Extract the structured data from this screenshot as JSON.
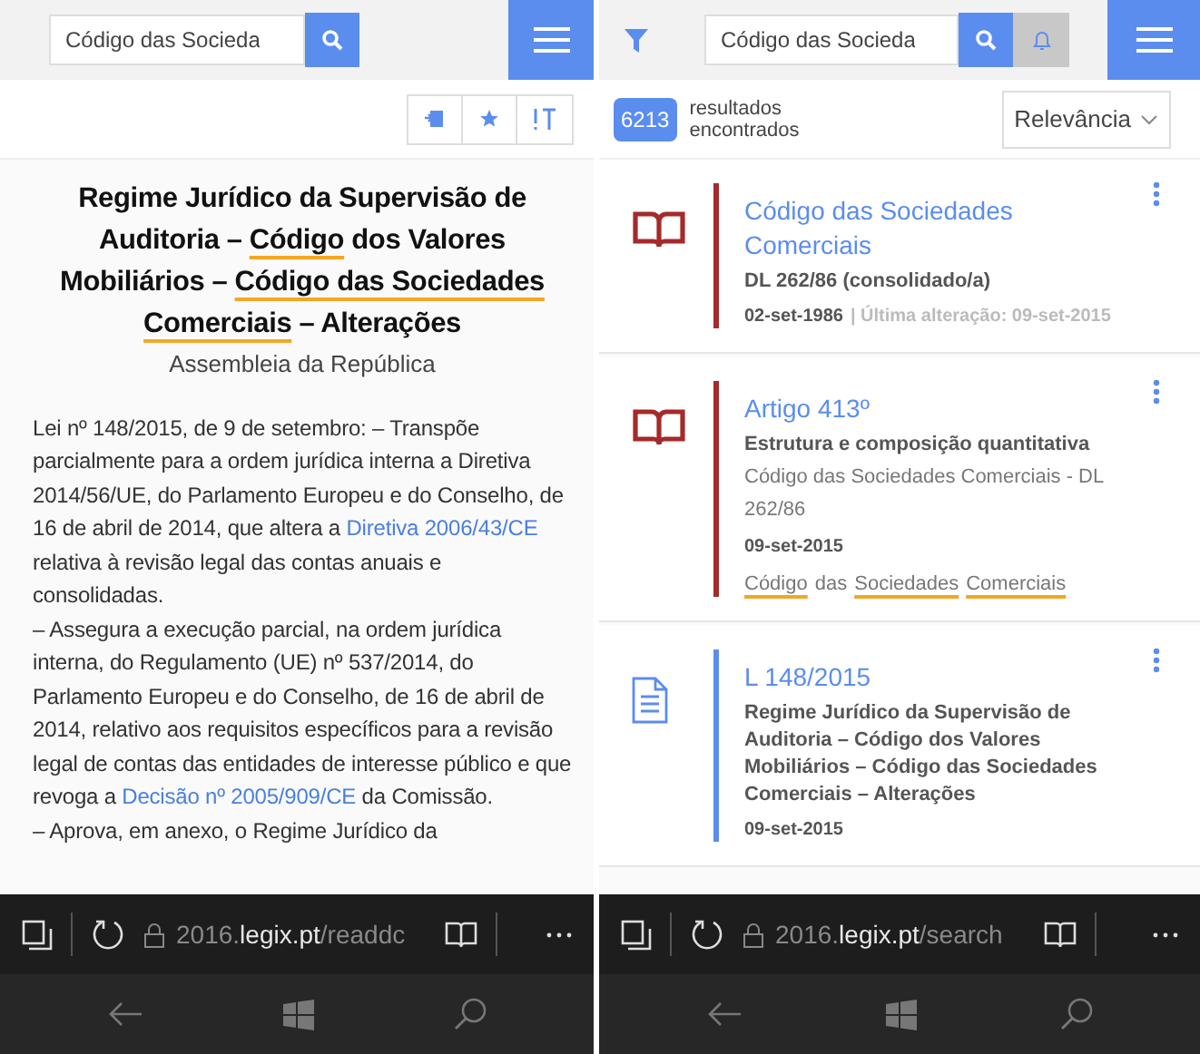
{
  "document_pane": {
    "search": {
      "value": "Código das Socieda"
    },
    "title": [
      {
        "text": "Regime Jurídico da Supervisão de Auditoria – ",
        "highlighted": false
      },
      {
        "text": "Código",
        "highlighted": true
      },
      {
        "text": " dos Valores Mobiliários – ",
        "highlighted": false
      },
      {
        "text": "Código das Sociedades Comerciais",
        "highlighted": true
      },
      {
        "text": " – Alterações",
        "highlighted": false
      }
    ],
    "author": "Assembleia da República",
    "paragraphs": [
      [
        {
          "kind": "text",
          "text": "Lei nº 148/2015, de 9 de setembro: – Transpõe parcialmente para a ordem jurídica interna a Diretiva 2014/56/UE, do Parlamento Europeu e do Conselho, de 16 de abril de 2014, que altera a "
        },
        {
          "kind": "link",
          "text": "Diretiva 2006/43/CE"
        },
        {
          "kind": "text",
          "text": " relativa à revisão legal das contas anuais e consolidadas."
        }
      ],
      [
        {
          "kind": "text",
          "text": "– Assegura a execução parcial, na ordem jurídica interna, do Regulamento (UE) nº 537/2014, do Parlamento Europeu e do Conselho, de 16 de abril de 2014, relativo aos requisitos específicos para a revisão legal de contas das entidades de interesse público e que revoga a "
        },
        {
          "kind": "link",
          "text": "Decisão nº 2005/909/CE"
        },
        {
          "kind": "text",
          "text": " da Comissão."
        }
      ],
      [
        {
          "kind": "text",
          "text": "– Aprova, em anexo, o Regime Jurídico da"
        }
      ]
    ],
    "address_bar": [
      {
        "text": "2016.",
        "emphasis": false
      },
      {
        "text": "legix.pt",
        "emphasis": true
      },
      {
        "text": "/readdc",
        "emphasis": false
      }
    ]
  },
  "results_pane": {
    "search": {
      "value": "Código das Socieda"
    },
    "count": "6213",
    "count_label": "resultados encontrados",
    "sort": "Relevância",
    "results": [
      {
        "kind": "book",
        "color": "#a52a2a",
        "title": "Código das Sociedades Comerciais",
        "subtitle": "DL 262/86 (consolidado/a)",
        "date": "02-set-1986",
        "updated": "| Última alteração: 09-set-2015"
      },
      {
        "kind": "book",
        "color": "#a52a2a",
        "title": "Artigo 413º",
        "subtitle": "Estrutura e composição quantitativa",
        "source": "Código das Sociedades Comerciais - DL 262/86",
        "date": "09-set-2015",
        "matches": [
          {
            "text": "Código",
            "highlighted": true
          },
          {
            "text": "das",
            "highlighted": false
          },
          {
            "text": "Sociedades",
            "highlighted": true
          },
          {
            "text": "Comerciais",
            "highlighted": true
          }
        ]
      },
      {
        "kind": "document",
        "color": "#5b8def",
        "title": "L 148/2015",
        "subtitle": "Regime Jurídico da Supervisão de Auditoria – Código dos Valores Mobiliários – Código das Sociedades Comerciais – Alterações",
        "date": "09-set-2015"
      }
    ],
    "address_bar": [
      {
        "text": "2016.",
        "emphasis": false
      },
      {
        "text": "legix.pt",
        "emphasis": true
      },
      {
        "text": "/search",
        "emphasis": false
      }
    ]
  }
}
